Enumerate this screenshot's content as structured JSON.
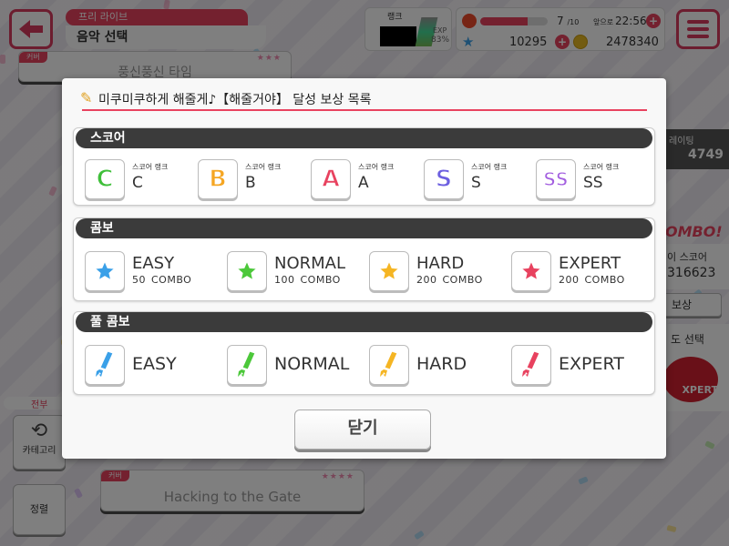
{
  "header": {
    "mode": "프리 라이브",
    "title": "음악 선택",
    "rank_label": "랭크",
    "exp_label": "EXP",
    "exp_percent": "83%",
    "life_count": "7",
    "life_max": "/10",
    "life_fraction": 0.7,
    "timer_label": "앞으로",
    "timer": "22:56",
    "stars": "10295",
    "coins": "2478340"
  },
  "background": {
    "song_titles": [
      "풍신풍신 타임",
      "Hacking to the Gate"
    ],
    "cover_label": "커버",
    "rating_label": "레이팅",
    "rating_value": "4749",
    "combo_logo": "OMBO!",
    "hiscore_label": "이 스코어",
    "hiscore_value": "316623",
    "reward_label": "보상",
    "difficulty_label": "도 선택",
    "difficulty_badge": "XPERT",
    "all_label": "전부",
    "category_label": "카테고리",
    "sort_label": "정렬"
  },
  "modal": {
    "title": "미쿠미쿠하게 해줄게♪【해줄거야】 달성 보상 목록",
    "close_label": "닫기",
    "sections": {
      "score": {
        "title": "스코어",
        "items": [
          {
            "letter": "C",
            "caption": "스코어 랭크",
            "value": "C",
            "color": "#3fbf3a"
          },
          {
            "letter": "B",
            "caption": "스코어 랭크",
            "value": "B",
            "color": "#f5a623"
          },
          {
            "letter": "A",
            "caption": "스코어 랭크",
            "value": "A",
            "color": "#e8425f"
          },
          {
            "letter": "S",
            "caption": "스코어 랭크",
            "value": "S",
            "color": "#6c5fe0"
          },
          {
            "letter": "SS",
            "caption": "스코어 랭크",
            "value": "SS",
            "color": "#a35fe0"
          }
        ]
      },
      "combo": {
        "title": "콤보",
        "items": [
          {
            "name": "EASY",
            "count": "50",
            "unit": "COMBO",
            "color": "#3aa0e8",
            "icon": "star-icon"
          },
          {
            "name": "NORMAL",
            "count": "100",
            "unit": "COMBO",
            "color": "#4cc83a",
            "icon": "star-icon"
          },
          {
            "name": "HARD",
            "count": "200",
            "unit": "COMBO",
            "color": "#f5b523",
            "icon": "star-icon"
          },
          {
            "name": "EXPERT",
            "count": "200",
            "unit": "COMBO",
            "color": "#e8425f",
            "icon": "star-icon"
          }
        ]
      },
      "full_combo": {
        "title": "풀 콤보",
        "items": [
          {
            "name": "EASY",
            "color": "#3aa0e8",
            "icon": "full-combo-icon"
          },
          {
            "name": "NORMAL",
            "color": "#4cc83a",
            "icon": "full-combo-icon"
          },
          {
            "name": "HARD",
            "color": "#f5b523",
            "icon": "full-combo-icon"
          },
          {
            "name": "EXPERT",
            "color": "#e8425f",
            "icon": "full-combo-icon"
          }
        ]
      }
    }
  }
}
